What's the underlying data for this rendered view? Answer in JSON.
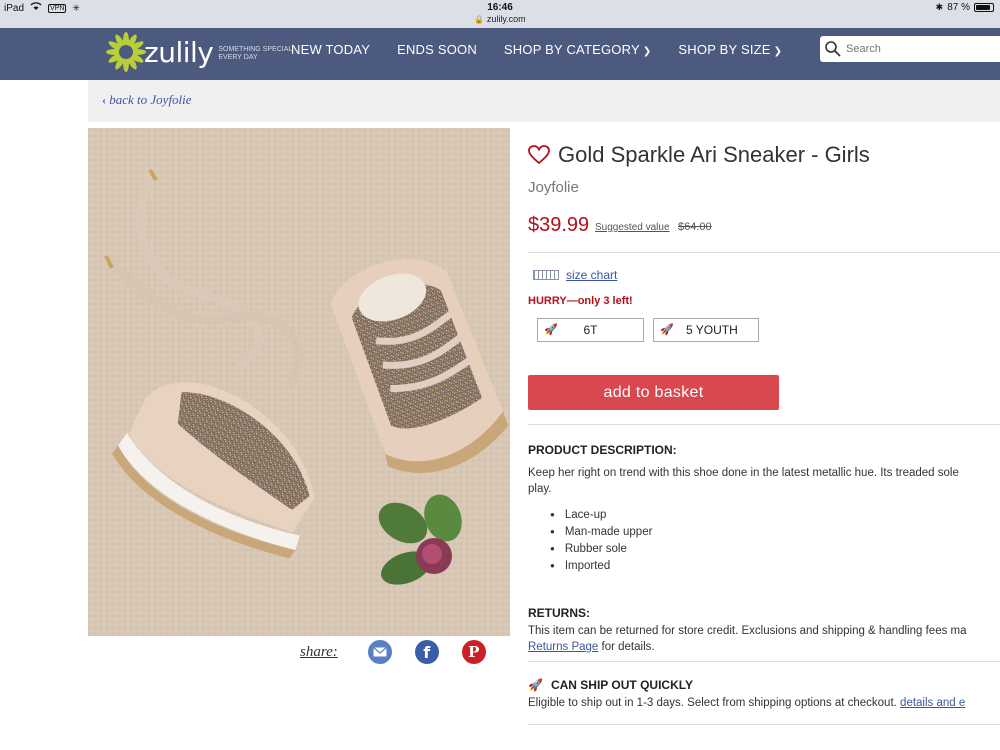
{
  "status_bar": {
    "device": "iPad",
    "vpn": "VPN",
    "time": "16:46",
    "url": "zulily.com",
    "battery_text": "87 %",
    "battery_level": 0.87
  },
  "header": {
    "logo_text": "zulily",
    "tagline": "SOMETHING SPECIAL EVERY DAY",
    "nav": [
      "NEW TODAY",
      "ENDS SOON",
      "SHOP BY CATEGORY",
      "SHOP BY SIZE"
    ],
    "search_placeholder": "Search"
  },
  "breadcrumb": {
    "back_label": "back to Joyfolie"
  },
  "product": {
    "title": "Gold Sparkle Ari Sneaker - Girls",
    "brand": "Joyfolie",
    "price": "$39.99",
    "suggested_label": "Suggested value",
    "original_price": "$64.00",
    "size_chart_label": "size chart",
    "stock_warning": "HURRY—only 3 left!",
    "sizes": [
      "6T",
      "5 YOUTH"
    ],
    "add_to_basket": "add to basket"
  },
  "share": {
    "label": "share:"
  },
  "description": {
    "heading": "PRODUCT DESCRIPTION:",
    "text": "Keep her right on trend with this shoe done in the latest metallic hue. Its treaded sole",
    "text_line2": "play.",
    "bullets": [
      "Lace-up",
      "Man-made upper",
      "Rubber sole",
      "Imported"
    ]
  },
  "returns": {
    "heading": "RETURNS:",
    "text": "This item can be returned for store credit. Exclusions and shipping & handling fees ma",
    "link": "Returns Page",
    "text_after": " for details."
  },
  "shipping": {
    "heading": "CAN SHIP OUT QUICKLY",
    "text": "Eligible to ship out in 1-3 days. Select from shipping options at checkout. ",
    "link": "details and e"
  },
  "colors": {
    "nav_bg": "#4d5a80",
    "price_red": "#b3101a",
    "add_button": "#d9474f",
    "link_blue": "#3a56a0"
  }
}
